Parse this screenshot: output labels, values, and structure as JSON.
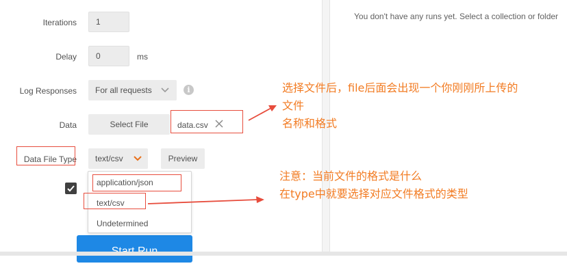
{
  "runner": {
    "iterations": {
      "label": "Iterations",
      "value": "1"
    },
    "delay": {
      "label": "Delay",
      "value": "0",
      "unit": "ms"
    },
    "log_responses": {
      "label": "Log Responses",
      "value": "For all requests",
      "info_icon": "info-icon"
    },
    "data": {
      "label": "Data",
      "select_file_label": "Select File",
      "file_name": "data.csv",
      "clear_icon": "close-icon"
    },
    "data_file_type": {
      "label": "Data File Type",
      "value": "text/csv",
      "preview_label": "Preview",
      "options": [
        "application/json",
        "text/csv",
        "Undetermined"
      ]
    },
    "checkbox": {
      "checked": true
    },
    "start_run_label": "Start Run"
  },
  "right_panel": {
    "message": "You don't have any runs yet. Select a collection or folder"
  },
  "annotations": {
    "note1": [
      "选择文件后，file后面会出现一个你刚刚所上传的",
      "文件",
      "名称和格式"
    ],
    "note2": [
      "注意：当前文件的格式是什么",
      "在type中就要选择对应文件格式的类型"
    ]
  },
  "colors": {
    "annotation_text": "#f27b22",
    "annotation_box": "#e74c3c",
    "start_button": "#1e88e5",
    "dropdown_arrow": "#e8701a"
  }
}
